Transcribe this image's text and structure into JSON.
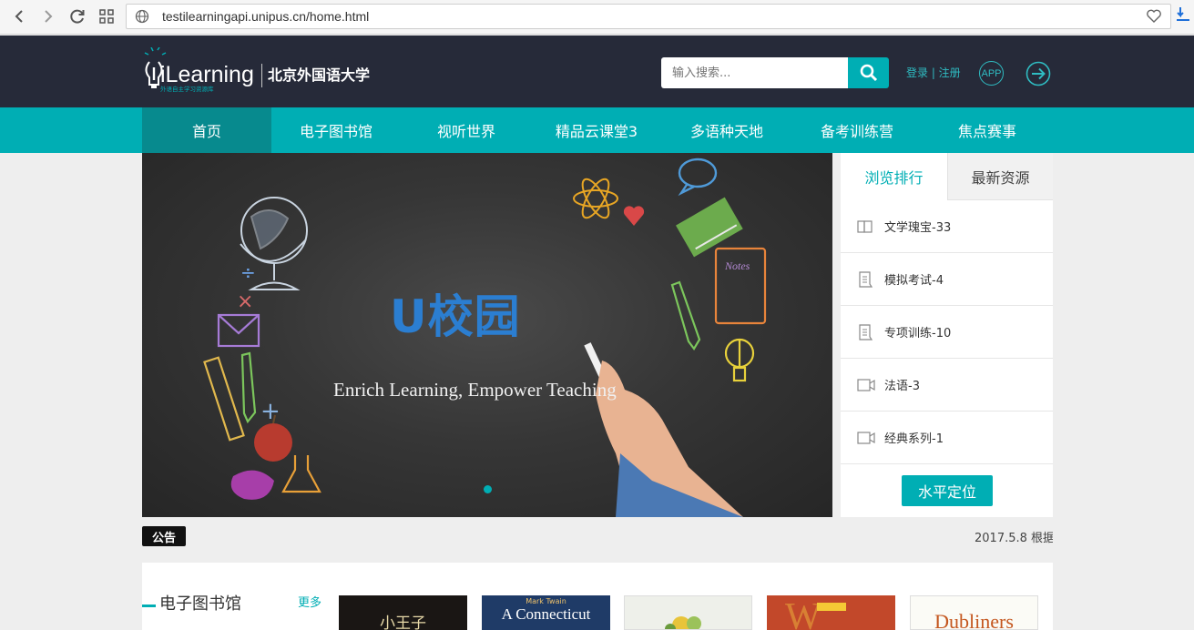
{
  "browser": {
    "url": "testilearningapi.unipus.cn/home.html"
  },
  "header": {
    "logo_text": "iLearning",
    "logo_subtext": "外语自主学习资源库",
    "university": "北京外国语大学",
    "search_placeholder": "输入搜索...",
    "login_label": "登录 | 注册",
    "app_label": "APP"
  },
  "nav": {
    "items": [
      {
        "label": "首页"
      },
      {
        "label": "电子图书馆"
      },
      {
        "label": "视听世界"
      },
      {
        "label": "精品云课堂3"
      },
      {
        "label": "多语种天地"
      },
      {
        "label": "备考训练营"
      },
      {
        "label": "焦点赛事"
      }
    ]
  },
  "banner": {
    "logo": "U校园",
    "slogan": "Enrich Learning, Empower Teaching",
    "chalk_notes": "Notes"
  },
  "side_panel": {
    "tabs": [
      {
        "label": "浏览排行"
      },
      {
        "label": "最新资源"
      }
    ],
    "items": [
      {
        "label": "文学瑰宝-33",
        "icon": "book-icon"
      },
      {
        "label": "模拟考试-4",
        "icon": "document-icon"
      },
      {
        "label": "专项训练-10",
        "icon": "document-icon"
      },
      {
        "label": "法语-3",
        "icon": "video-icon"
      },
      {
        "label": "经典系列-1",
        "icon": "video-icon"
      }
    ],
    "button_label": "水平定位"
  },
  "notice": {
    "tag": "公告",
    "text": "2017.5.8 根据"
  },
  "library": {
    "title": "电子图书馆",
    "more_label": "更多",
    "books": [
      {
        "cover_text": "小王子"
      },
      {
        "cover_text": "A Connecticut",
        "cover_subtext": "Mark Twain"
      },
      {
        "cover_text": ""
      },
      {
        "cover_text": "W"
      },
      {
        "cover_text": "Dubliners"
      }
    ]
  },
  "colors": {
    "accent": "#00aeb4",
    "header_bg": "#262a39",
    "nav_active": "#078a8e"
  }
}
